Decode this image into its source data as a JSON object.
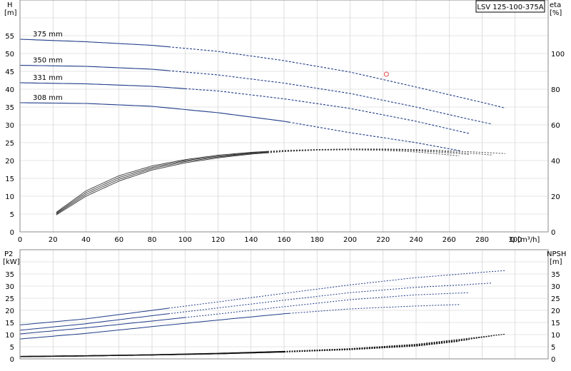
{
  "model_label": "LSV 125-100-375A",
  "top": {
    "left_axis_label": [
      "H",
      "[m]"
    ],
    "right_axis_label": [
      "eta",
      "[%]"
    ],
    "x_axis_label": "Q [m³/h]",
    "x_ticks": [
      "0",
      "20",
      "40",
      "60",
      "80",
      "100",
      "120",
      "140",
      "160",
      "180",
      "200",
      "220",
      "240",
      "260",
      "280",
      "300"
    ],
    "y_ticks": [
      "0",
      "5",
      "10",
      "15",
      "20",
      "25",
      "30",
      "35",
      "40",
      "45",
      "50",
      "55"
    ],
    "eta_ticks": [
      "0",
      "20",
      "40",
      "60",
      "80",
      "100"
    ]
  },
  "bottom": {
    "left_axis_label": [
      "P2",
      "[kW]"
    ],
    "right_axis_label": [
      "NPSH",
      "[m]"
    ],
    "y_ticks": [
      "0",
      "5",
      "10",
      "15",
      "20",
      "25",
      "30",
      "35"
    ],
    "npsh_ticks": [
      "0",
      "5",
      "10",
      "15",
      "20",
      "25",
      "30",
      "35"
    ]
  },
  "colors": {
    "curve": "#1f3c88",
    "grid": "#c9c9c9",
    "marker": "#e05050",
    "eta": "#333333"
  },
  "chart_data": [
    {
      "type": "line",
      "title": "",
      "xlabel": "Q [m³/h]",
      "ylabel": "H [m]",
      "y2label": "eta [%]",
      "xlim": [
        0,
        320
      ],
      "ylim": [
        0,
        60
      ],
      "y2lim": [
        0,
        120
      ],
      "grid": true,
      "series": [
        {
          "name": "375 mm",
          "x": [
            0,
            40,
            80,
            120,
            160,
            200,
            240,
            280,
            294
          ],
          "y": [
            54,
            53.3,
            52.3,
            50.6,
            48,
            44.8,
            40.6,
            36.3,
            34.7
          ],
          "solid_until": 90
        },
        {
          "name": "350 mm",
          "x": [
            0,
            40,
            80,
            120,
            160,
            200,
            240,
            270,
            287
          ],
          "y": [
            46.7,
            46.4,
            45.6,
            44,
            41.7,
            38.8,
            35,
            31.8,
            30.1
          ],
          "solid_until": 90
        },
        {
          "name": "331 mm",
          "x": [
            0,
            40,
            80,
            120,
            160,
            200,
            240,
            272
          ],
          "y": [
            41.8,
            41.5,
            40.8,
            39.5,
            37.3,
            34.6,
            31,
            27.6
          ],
          "solid_until": 100
        },
        {
          "name": "308 mm",
          "x": [
            0,
            40,
            80,
            120,
            160,
            200,
            240,
            267
          ],
          "y": [
            36.2,
            36,
            35.2,
            33.4,
            31,
            27.8,
            25,
            22.7
          ],
          "solid_until": 165
        }
      ],
      "efficiency_series": [
        {
          "x": [
            22,
            40,
            60,
            80,
            100,
            120,
            140,
            160,
            180,
            200,
            220,
            240,
            260,
            280,
            294
          ],
          "y": [
            11,
            23,
            31.5,
            37,
            40.5,
            43,
            44.6,
            45.7,
            46.2,
            46.5,
            46.5,
            46.2,
            45.5,
            44.6,
            43.9
          ]
        },
        {
          "x": [
            22,
            40,
            60,
            80,
            100,
            120,
            140,
            160,
            180,
            200,
            220,
            240,
            260,
            280,
            287
          ],
          "y": [
            10.5,
            22,
            30.5,
            36.2,
            40,
            42.5,
            44.3,
            45.5,
            46.1,
            46.4,
            46.3,
            45.8,
            44.9,
            43.6,
            43
          ]
        },
        {
          "x": [
            22,
            40,
            60,
            80,
            100,
            120,
            140,
            160,
            180,
            200,
            220,
            240,
            260,
            272
          ],
          "y": [
            10,
            21,
            29.5,
            35.5,
            39.4,
            42,
            44,
            45.3,
            46,
            46.3,
            46.1,
            45.5,
            44.3,
            43.4
          ]
        },
        {
          "x": [
            22,
            40,
            60,
            80,
            100,
            120,
            140,
            160,
            180,
            200,
            220,
            240,
            260,
            267
          ],
          "y": [
            9.5,
            20,
            28.5,
            34.7,
            38.7,
            41.5,
            43.6,
            45,
            45.8,
            46,
            45.7,
            44.8,
            43.2,
            42.4
          ]
        }
      ],
      "duty_point": {
        "x": 222,
        "y": 44.2
      }
    },
    {
      "type": "line",
      "title": "",
      "xlabel": "",
      "ylabel": "P2 [kW]",
      "y2label": "NPSH [m]",
      "xlim": [
        0,
        320
      ],
      "ylim": [
        0,
        40
      ],
      "y2lim": [
        0,
        40
      ],
      "grid": true,
      "series": [
        {
          "name": "375 mm",
          "x": [
            0,
            40,
            80,
            120,
            160,
            200,
            240,
            280,
            294
          ],
          "y": [
            14,
            16.5,
            20,
            23.5,
            27,
            30.5,
            33.5,
            35.7,
            36.4
          ],
          "solid_until": 90
        },
        {
          "name": "350 mm",
          "x": [
            0,
            40,
            80,
            120,
            160,
            200,
            240,
            270,
            287
          ],
          "y": [
            11.8,
            14.5,
            17.8,
            21,
            24.2,
            27.3,
            29.5,
            30.6,
            31.3
          ],
          "solid_until": 90
        },
        {
          "name": "331 mm",
          "x": [
            0,
            40,
            80,
            120,
            160,
            200,
            240,
            272
          ],
          "y": [
            10.3,
            12.8,
            15.6,
            18.5,
            21.5,
            24.4,
            26.4,
            27.3
          ],
          "solid_until": 100
        },
        {
          "name": "308 mm",
          "x": [
            0,
            40,
            80,
            120,
            160,
            200,
            240,
            267
          ],
          "y": [
            8.2,
            10.5,
            13.3,
            16,
            18.6,
            20.6,
            21.8,
            22.4
          ],
          "solid_until": 165
        }
      ],
      "npsh_series": [
        {
          "x": [
            0,
            40,
            80,
            120,
            160,
            200,
            240,
            270,
            294
          ],
          "y": [
            1,
            1.3,
            1.7,
            2.3,
            3.1,
            4.2,
            6,
            8.3,
            10.2
          ]
        },
        {
          "x": [
            0,
            40,
            80,
            120,
            160,
            200,
            240,
            270,
            287
          ],
          "y": [
            1,
            1.3,
            1.7,
            2.2,
            3,
            4,
            5.7,
            7.9,
            9.6
          ]
        },
        {
          "x": [
            0,
            40,
            80,
            120,
            160,
            200,
            240,
            272
          ],
          "y": [
            0.9,
            1.2,
            1.6,
            2.1,
            2.9,
            3.9,
            5.5,
            7.9
          ]
        },
        {
          "x": [
            0,
            40,
            80,
            120,
            160,
            200,
            240,
            267
          ],
          "y": [
            0.9,
            1.2,
            1.6,
            2.1,
            2.8,
            3.8,
            5.3,
            7.3
          ]
        }
      ]
    }
  ]
}
